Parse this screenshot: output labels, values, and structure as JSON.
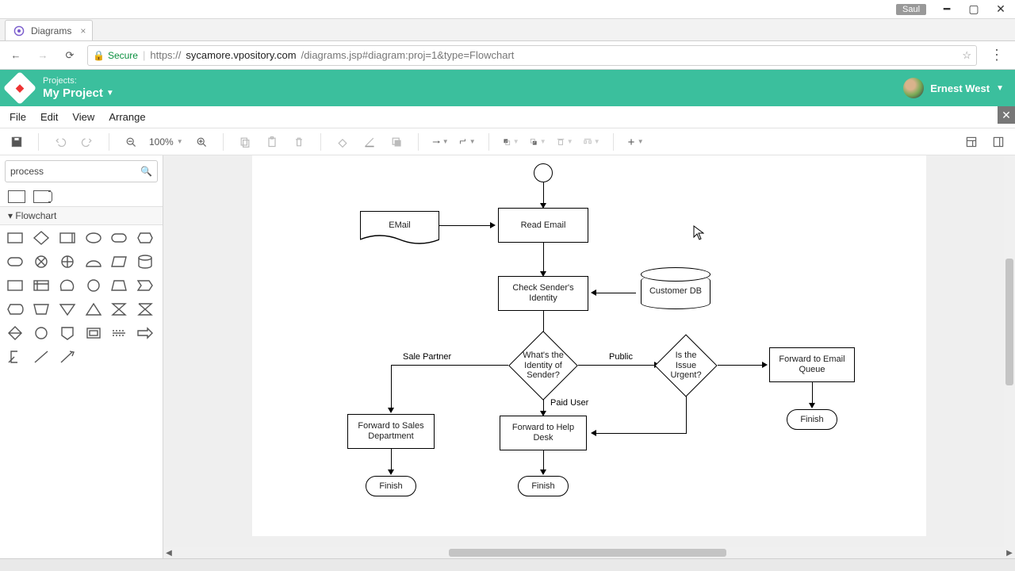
{
  "window": {
    "badge": "Saul",
    "tab_title": "Diagrams",
    "url_secure": "Secure",
    "url_scheme": "https://",
    "url_host": "sycamore.vpository.com",
    "url_path": "/diagrams.jsp#diagram:proj=1&type=Flowchart"
  },
  "header": {
    "projects_label": "Projects:",
    "project_name": "My Project",
    "user_name": "Ernest West"
  },
  "menubar": {
    "file": "File",
    "edit": "Edit",
    "view": "View",
    "arrange": "Arrange"
  },
  "toolbar": {
    "zoom": "100%"
  },
  "sidebar": {
    "search_value": "process",
    "group_title": "▾ Flowchart"
  },
  "diagram": {
    "nodes": {
      "start": "",
      "email": "EMail",
      "read_email": "Read Email",
      "check_identity": "Check Sender's Identity",
      "customer_db": "Customer DB",
      "identity_q": "What's the Identity of Sender?",
      "urgent_q": "Is the Issue Urgent?",
      "fwd_sales": "Forward to Sales Department",
      "fwd_help": "Forward to Help Desk",
      "fwd_queue": "Forward to Email Queue",
      "finish1": "Finish",
      "finish2": "Finish",
      "finish3": "Finish"
    },
    "edge_labels": {
      "sale_partner": "Sale Partner",
      "public": "Public",
      "paid_user": "Paid User"
    }
  }
}
